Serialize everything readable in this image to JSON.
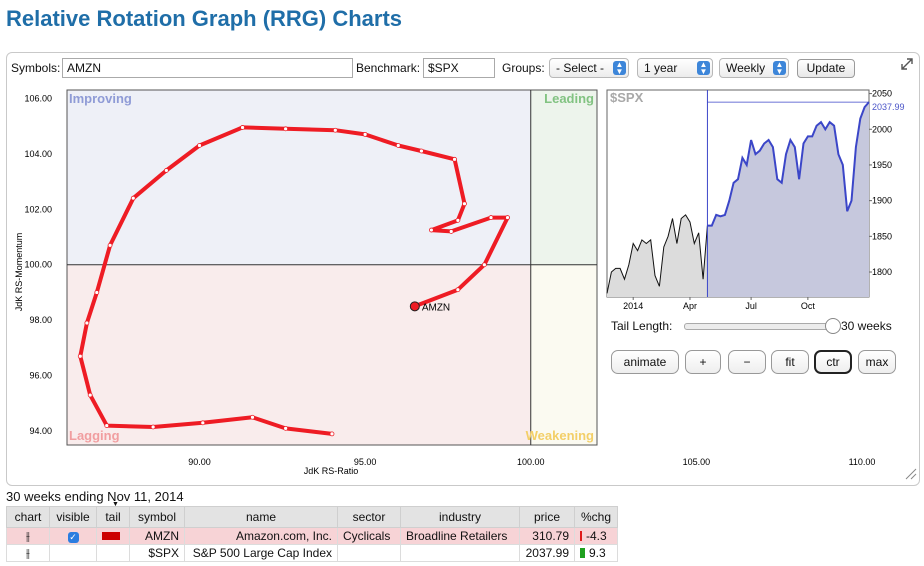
{
  "page_title": "Relative Rotation Graph (RRG) Charts",
  "controls": {
    "symbols_label": "Symbols:",
    "symbols_value": "AMZN",
    "benchmark_label": "Benchmark:",
    "benchmark_value": "$SPX",
    "groups_label": "Groups:",
    "groups_value": "- Select -",
    "period_value": "1 year",
    "interval_value": "Weekly",
    "update_label": "Update",
    "expand_icon": "expand-icon"
  },
  "rrg": {
    "quadrants": {
      "improving": "Improving",
      "leading": "Leading",
      "lagging": "Lagging",
      "weakening": "Weakening"
    },
    "quadrant_colors": {
      "improving": "#eef0f7",
      "leading": "#edf4ec",
      "lagging": "#f9ecec",
      "weakening": "#fbfaf1"
    },
    "quadrant_label_colors": {
      "improving": "#8f9bd6",
      "leading": "#82c382",
      "lagging": "#f19ea0",
      "weakening": "#f3cf68"
    },
    "xlabel": "JdK RS-Ratio",
    "ylabel": "JdK RS-Momentum",
    "xlim": [
      86.0,
      102.0
    ],
    "ylim": [
      93.5,
      106.3
    ],
    "xticks": [
      "90.00",
      "95.00",
      "100.00",
      "105.00",
      "110.00"
    ],
    "yticks": [
      "106.00",
      "104.00",
      "102.00",
      "100.00",
      "98.00",
      "96.00",
      "94.00"
    ],
    "current_label": "AMZN",
    "tail_color": "#ee1c24"
  },
  "chart_data": [
    {
      "type": "line",
      "title": "",
      "xlabel": "JdK RS-Ratio",
      "ylabel": "JdK RS-Momentum",
      "xlim": [
        86.0,
        102.0
      ],
      "ylim": [
        93.5,
        106.3
      ],
      "series": [
        {
          "name": "AMZN",
          "x": [
            94.0,
            92.6,
            91.6,
            90.1,
            88.6,
            87.2,
            86.7,
            86.4,
            86.6,
            86.9,
            87.3,
            88.0,
            89.0,
            90.0,
            91.3,
            92.6,
            94.1,
            95.0,
            96.0,
            96.7,
            97.7,
            98.0,
            97.8,
            97.0,
            97.6,
            98.8,
            99.3,
            98.6,
            97.8,
            96.5
          ],
          "y": [
            93.9,
            94.1,
            94.5,
            94.3,
            94.15,
            94.2,
            95.3,
            96.7,
            97.9,
            99.0,
            100.7,
            102.4,
            103.4,
            104.3,
            104.95,
            104.9,
            104.85,
            104.7,
            104.3,
            104.1,
            103.8,
            102.2,
            101.6,
            101.25,
            101.2,
            101.7,
            101.7,
            100.0,
            99.1,
            98.5
          ]
        }
      ]
    },
    {
      "type": "line",
      "title": "$SPX",
      "xlabel": "",
      "ylabel": "",
      "x_tick_labels": [
        "2014",
        "Apr",
        "Jul",
        "Oct"
      ],
      "y_tick_labels": [
        "2050",
        "2000",
        "1950",
        "1900",
        "1850",
        "1800"
      ],
      "ylim": [
        1765,
        2055
      ],
      "tail_start_index": 23,
      "last_value_label": "2037.99",
      "series": [
        {
          "name": "$SPX",
          "values": [
            1770,
            1800,
            1805,
            1805,
            1790,
            1810,
            1840,
            1830,
            1845,
            1840,
            1845,
            1795,
            1780,
            1835,
            1850,
            1875,
            1840,
            1875,
            1880,
            1870,
            1840,
            1855,
            1790,
            1865,
            1865,
            1880,
            1878,
            1880,
            1900,
            1925,
            1930,
            1960,
            1950,
            1985,
            1965,
            1970,
            1980,
            1985,
            1975,
            1930,
            1925,
            1965,
            1985,
            1975,
            1930,
            1980,
            1990,
            1990,
            2005,
            2010,
            2000,
            2010,
            2005,
            1965,
            1950,
            1885,
            1900,
            1975,
            2015,
            2031,
            2037.99
          ]
        }
      ]
    }
  ],
  "tail": {
    "label": "Tail Length:",
    "value_label": "30 weeks"
  },
  "buttons": {
    "animate": "animate",
    "plus": "+",
    "minus": "−",
    "fit": "fit",
    "ctr": "ctr",
    "max": "max"
  },
  "summary": {
    "ending": "30 weeks ending Nov 11, 2014"
  },
  "table": {
    "headers": [
      "chart",
      "visible",
      "tail",
      "symbol",
      "name",
      "sector",
      "industry",
      "price",
      "%chg"
    ],
    "rows": [
      {
        "symbol": "AMZN",
        "name": "Amazon.com, Inc.",
        "sector": "Cyclicals",
        "industry": "Broadline Retailers",
        "price": "310.79",
        "chg": "-4.3",
        "chg_color": "#e01a1a",
        "visible": true,
        "tail_color": "#cc0000",
        "row_color": "#f7d3d6"
      },
      {
        "symbol": "$SPX",
        "name": "S&P 500 Large Cap Index",
        "sector": "",
        "industry": "",
        "price": "2037.99",
        "chg": "9.3",
        "chg_color": "#1fa01f",
        "visible": false,
        "tail_color": "",
        "row_color": "#ffffff"
      }
    ]
  }
}
